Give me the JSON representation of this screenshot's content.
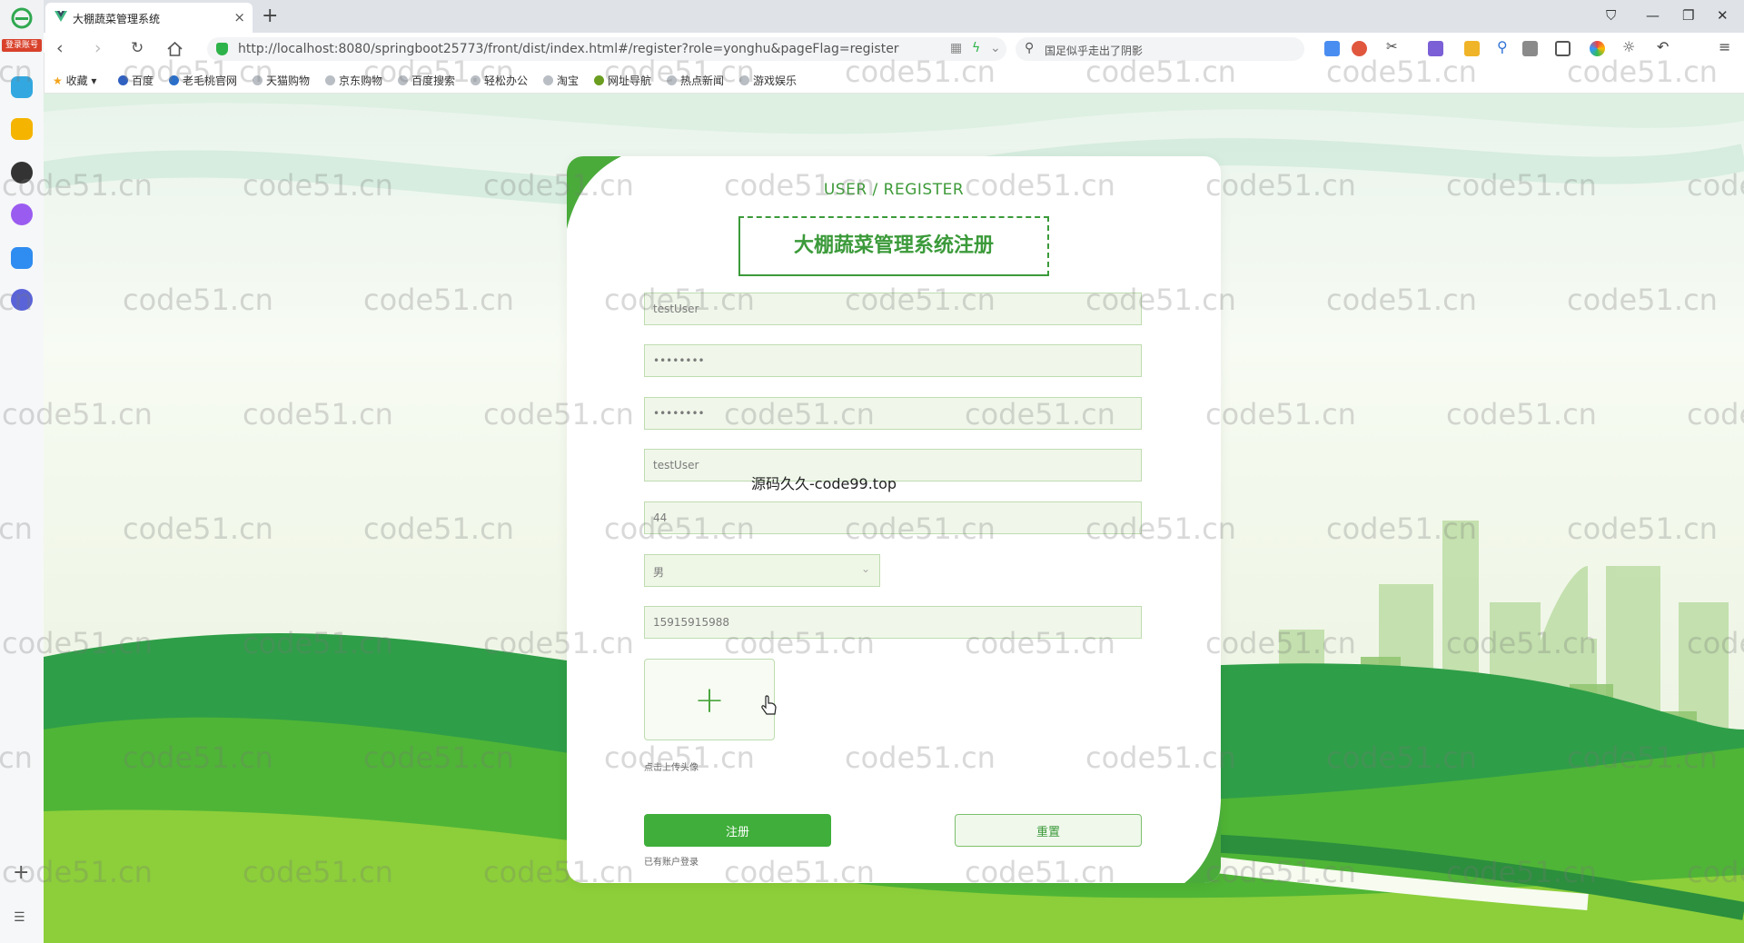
{
  "browser": {
    "logo_badge": "登录账号",
    "tab_title": "大棚蔬菜管理系统",
    "url": "http://localhost:8080/springboot25773/front/dist/index.html#/register?role=yonghu&pageFlag=register",
    "search_placeholder": "国足似乎走出了阴影",
    "bookmarks": [
      "收藏",
      "百度",
      "老毛桃官网",
      "天猫购物",
      "京东购物",
      "百度搜索",
      "轻松办公",
      "淘宝",
      "网址导航",
      "热点新闻",
      "游戏娱乐"
    ]
  },
  "register": {
    "subtitle": "USER / REGISTER",
    "title": "大棚蔬菜管理系统注册",
    "fields": {
      "account": "testUser",
      "password": "••••••••",
      "confirm_password": "••••••••",
      "name": "testUser",
      "age": "44",
      "sex": "男",
      "phone": "15915915988"
    },
    "upload_plus": "+",
    "upload_hint": "点击上传头像",
    "register_button": "注册",
    "reset_button": "重置",
    "login_link": "已有账户登录"
  },
  "overlay_text": "源码久久-code99.top",
  "watermark_text": "code51.cn",
  "colors": {
    "accent": "#3fae3a",
    "field_bg": "#f0f7ea",
    "field_border": "#bedcb0",
    "title_green": "#3b9a3a"
  },
  "icons": [
    "browser-logo-icon",
    "vue-favicon-icon",
    "back-icon",
    "forward-icon",
    "reload-icon",
    "home-icon",
    "shield-icon",
    "search-icon",
    "star-icon",
    "plus-icon",
    "list-icon",
    "hand-cursor-icon"
  ]
}
